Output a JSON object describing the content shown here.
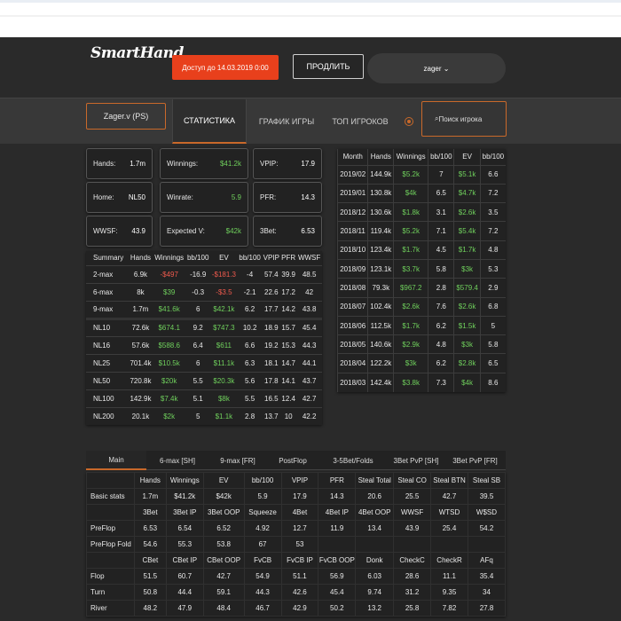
{
  "header": {
    "logo": "SmartHand",
    "access_label": "Доступ до 14.03.2019 0:00",
    "extend_label": "ПРОДЛИТЬ",
    "user": "zager ⌄"
  },
  "nav": {
    "account": "Zager.v (PS)",
    "tabs": [
      "СТАТИСТИКА",
      "ГРАФИК ИГРЫ",
      "ТОП ИГРОКОВ"
    ],
    "search_placeholder": "Поиск игрока"
  },
  "cards": [
    {
      "label": "Hands:",
      "value": "1.7m",
      "green": false
    },
    {
      "label": "Winnings:",
      "value": "$41.2k",
      "green": true
    },
    {
      "label": "VPIP:",
      "value": "17.9",
      "green": false
    },
    {
      "label": "Home:",
      "value": "NL50",
      "green": false
    },
    {
      "label": "Winrate:",
      "value": "5.9",
      "green": true
    },
    {
      "label": "PFR:",
      "value": "14.3",
      "green": false
    },
    {
      "label": "WWSF:",
      "value": "43.9",
      "green": false
    },
    {
      "label": "Expected V:",
      "value": "$42k",
      "green": true
    },
    {
      "label": "3Bet:",
      "value": "6.53",
      "green": false
    }
  ],
  "summary": {
    "headers": [
      "Summary",
      "Hands",
      "Winnings",
      "bb/100",
      "EV",
      "bb/100",
      "VPIP",
      "PFR",
      "WWSF"
    ],
    "groups": [
      [
        [
          "2-max",
          "6.9k",
          "-$497",
          "-16.9",
          "-$181.3",
          "-4",
          "57.4",
          "39.9",
          "48.5"
        ],
        [
          "6-max",
          "8k",
          "$39",
          "-0.3",
          "-$3.5",
          "-2.1",
          "22.6",
          "17.2",
          "42"
        ],
        [
          "9-max",
          "1.7m",
          "$41.6k",
          "6",
          "$42.1k",
          "6.2",
          "17.7",
          "14.2",
          "43.8"
        ]
      ],
      [
        [
          "NL10",
          "72.6k",
          "$674.1",
          "9.2",
          "$747.3",
          "10.2",
          "18.9",
          "15.7",
          "45.4"
        ],
        [
          "NL16",
          "57.6k",
          "$588.6",
          "6.4",
          "$611",
          "6.6",
          "19.2",
          "15.3",
          "44.3"
        ],
        [
          "NL25",
          "701.4k",
          "$10.5k",
          "6",
          "$11.1k",
          "6.3",
          "18.1",
          "14.7",
          "44.1"
        ],
        [
          "NL50",
          "720.8k",
          "$20k",
          "5.5",
          "$20.3k",
          "5.6",
          "17.8",
          "14.1",
          "43.7"
        ],
        [
          "NL100",
          "142.9k",
          "$7.4k",
          "5.1",
          "$8k",
          "5.5",
          "16.5",
          "12.4",
          "42.7"
        ],
        [
          "NL200",
          "20.1k",
          "$2k",
          "5",
          "$1.1k",
          "2.8",
          "13.7",
          "10",
          "42.2"
        ]
      ]
    ]
  },
  "monthly": {
    "headers": [
      "Month",
      "Hands",
      "Winnings",
      "bb/100",
      "EV",
      "bb/100"
    ],
    "rows": [
      [
        "2019/02",
        "144.9k",
        "$5.2k",
        "7",
        "$5.1k",
        "6.6"
      ],
      [
        "2019/01",
        "130.8k",
        "$4k",
        "6.5",
        "$4.7k",
        "7.2"
      ],
      [
        "2018/12",
        "130.6k",
        "$1.8k",
        "3.1",
        "$2.6k",
        "3.5"
      ],
      [
        "2018/11",
        "119.4k",
        "$5.2k",
        "7.1",
        "$5.4k",
        "7.2"
      ],
      [
        "2018/10",
        "123.4k",
        "$1.7k",
        "4.5",
        "$1.7k",
        "4.8"
      ],
      [
        "2018/09",
        "123.1k",
        "$3.7k",
        "5.8",
        "$3k",
        "5.3"
      ],
      [
        "2018/08",
        "79.3k",
        "$967.2",
        "2.8",
        "$579.4",
        "2.9"
      ],
      [
        "2018/07",
        "102.4k",
        "$2.6k",
        "7.6",
        "$2.6k",
        "6.8"
      ],
      [
        "2018/06",
        "112.5k",
        "$1.7k",
        "6.2",
        "$1.5k",
        "5"
      ],
      [
        "2018/05",
        "140.6k",
        "$2.9k",
        "4.8",
        "$3k",
        "5.8"
      ],
      [
        "2018/04",
        "122.2k",
        "$3k",
        "6.2",
        "$2.8k",
        "6.5"
      ],
      [
        "2018/03",
        "142.4k",
        "$3.8k",
        "7.3",
        "$4k",
        "8.6"
      ]
    ]
  },
  "bottom_tabs": [
    "Main",
    "6-max [SH]",
    "9-max [FR]",
    "PostFlop",
    "3-5Bet/Folds",
    "3Bet PvP [SH]",
    "3Bet PvP [FR]"
  ],
  "grid": {
    "h1": [
      "",
      "Hands",
      "Winnings",
      "EV",
      "bb/100",
      "VPIP",
      "PFR",
      "Steal Total",
      "Steal CO",
      "Steal BTN",
      "Steal SB"
    ],
    "r1": [
      "Basic stats",
      "1.7m",
      "$41.2k",
      "$42k",
      "5.9",
      "17.9",
      "14.3",
      "20.6",
      "25.5",
      "42.7",
      "39.5"
    ],
    "h2": [
      "",
      "3Bet",
      "3Bet IP",
      "3Bet OOP",
      "Squeeze",
      "4Bet",
      "4Bet IP",
      "4Bet OOP",
      "WWSF",
      "WTSD",
      "W$SD"
    ],
    "r2": [
      "PreFlop",
      "6.53",
      "6.54",
      "6.52",
      "4.92",
      "12.7",
      "11.9",
      "13.4",
      "43.9",
      "25.4",
      "54.2"
    ],
    "r3": [
      "PreFlop Fold",
      "54.6",
      "55.3",
      "53.8",
      "67",
      "53",
      "",
      "",
      "",
      "",
      ""
    ],
    "h3": [
      "",
      "CBet",
      "CBet IP",
      "CBet OOP",
      "FvCB",
      "FvCB IP",
      "FvCB OOP",
      "Donk",
      "CheckC",
      "CheckR",
      "AFq"
    ],
    "r4": [
      "Flop",
      "51.5",
      "60.7",
      "42.7",
      "54.9",
      "51.1",
      "56.9",
      "6.03",
      "28.6",
      "11.1",
      "35.4"
    ],
    "r5": [
      "Turn",
      "50.8",
      "44.4",
      "59.1",
      "44.3",
      "42.6",
      "45.4",
      "9.74",
      "31.2",
      "9.35",
      "34"
    ],
    "r6": [
      "River",
      "48.2",
      "47.9",
      "48.4",
      "46.7",
      "42.9",
      "50.2",
      "13.2",
      "25.8",
      "7.82",
      "27.8"
    ]
  }
}
